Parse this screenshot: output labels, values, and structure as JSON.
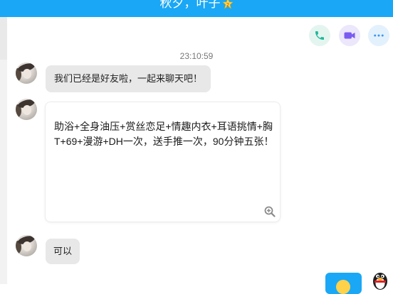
{
  "header": {
    "title": "秋夕，叶子"
  },
  "conversation": {
    "timestamp": "23:10:59",
    "messages": [
      {
        "sender": "contact",
        "text": "我们已经是好友啦，一起来聊天吧！"
      },
      {
        "sender": "contact",
        "text": "助浴+全身油压+赏丝恋足+情趣内衣+耳语挑情+胸T+69+漫游+DH一次，送手推一次，90分钟五张！"
      },
      {
        "sender": "contact",
        "text": "可以"
      }
    ]
  },
  "icons": {
    "call": "phone-icon",
    "video": "video-camera-icon",
    "more": "more-dots-icon",
    "zoom": "zoom-in-icon",
    "badge": "level-star-badge-icon"
  },
  "colors": {
    "header_bg": "#1aa7f6",
    "received_bubble": "#e8e8e8",
    "sent_bubble": "#1aa7f6",
    "call_icon": "#1fb89a",
    "video_icon": "#7b5cf0",
    "more_icon": "#3b97f0"
  }
}
